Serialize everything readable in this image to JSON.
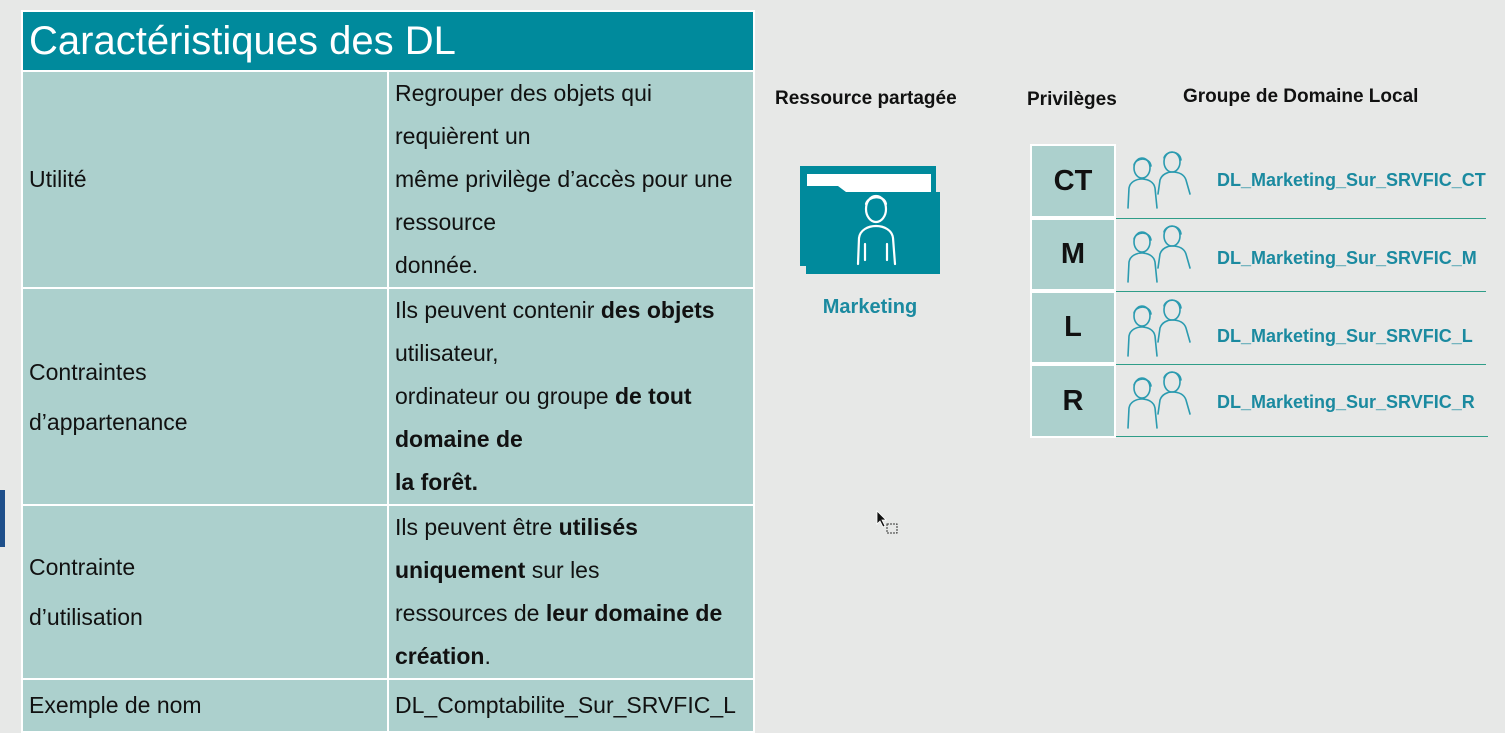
{
  "table": {
    "title": "Caractéristiques des DL",
    "rows": [
      {
        "label": "Utilité",
        "lines": [
          "Regrouper des objets qui requièrent un",
          "même privilège d’accès pour une ressource",
          "donnée."
        ]
      },
      {
        "label_lines": [
          "Contraintes",
          "d’appartenance"
        ],
        "l1_a": "Ils peuvent contenir ",
        "l1_b": "des objets",
        "l1_c": " utilisateur,",
        "l2_a": "ordinateur ou groupe ",
        "l2_b": "de tout domaine de",
        "l3_b": "la forêt."
      },
      {
        "label_lines": [
          "Contrainte",
          "d’utilisation"
        ],
        "l1_a": "Ils peuvent être ",
        "l1_b": "utilisés uniquement",
        "l1_c": " sur les",
        "l2_a": "ressources de ",
        "l2_b": "leur domaine de création",
        "l2_c": "."
      },
      {
        "label": "Exemple de nom",
        "value": "DL_Comptabilite_Sur_SRVFIC_L"
      }
    ]
  },
  "resource": {
    "title": "Ressource partagée",
    "folder_icon": "shared-folder-user-icon",
    "name": "Marketing"
  },
  "privileges": {
    "title": "Privilèges",
    "items": [
      "CT",
      "M",
      "L",
      "R"
    ]
  },
  "groups": {
    "title": "Groupe de Domaine Local",
    "icon": "user-group-icon",
    "items": [
      "DL_Marketing_Sur_SRVFIC_CT",
      "DL_Marketing_Sur_SRVFIC_M",
      "DL_Marketing_Sur_SRVFIC_L",
      "DL_Marketing_Sur_SRVFIC_R"
    ]
  },
  "colors": {
    "header_teal": "#008a9c",
    "cell_bg": "#acd0cd",
    "label_teal": "#1b8aa0",
    "line_green": "#2f9d88",
    "background": "#e7e8e7"
  }
}
